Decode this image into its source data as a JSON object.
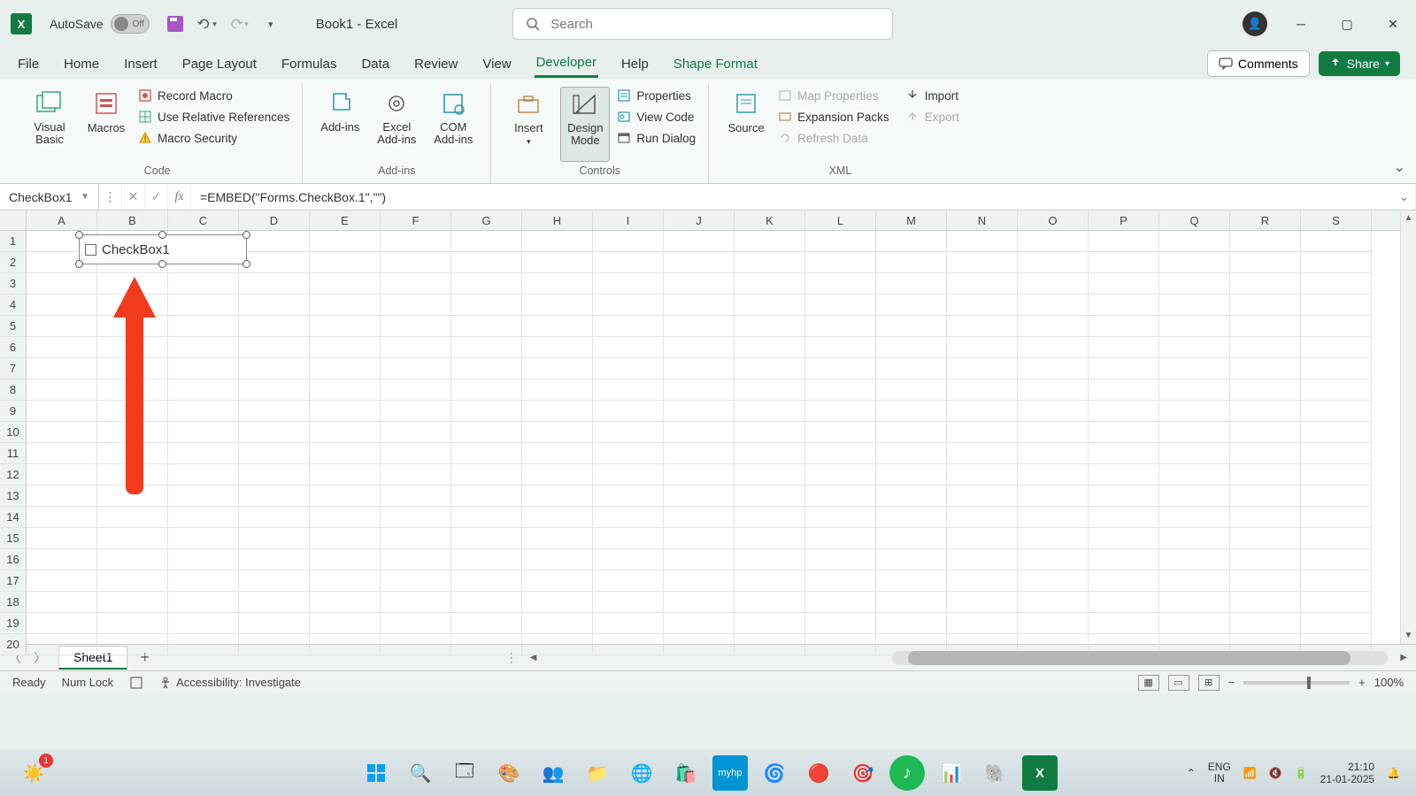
{
  "titlebar": {
    "autosave_label": "AutoSave",
    "autosave_state": "Off",
    "doc_title": "Book1  -  Excel",
    "search_placeholder": "Search"
  },
  "tabs": {
    "items": [
      "File",
      "Home",
      "Insert",
      "Page Layout",
      "Formulas",
      "Data",
      "Review",
      "View",
      "Developer",
      "Help",
      "Shape Format"
    ],
    "active": "Developer",
    "comments": "Comments",
    "share": "Share"
  },
  "ribbon": {
    "code": {
      "visual_basic": "Visual Basic",
      "macros": "Macros",
      "record_macro": "Record Macro",
      "use_relative": "Use Relative References",
      "macro_security": "Macro Security",
      "label": "Code"
    },
    "addins": {
      "addins": "Add-ins",
      "excel_addins": "Excel Add-ins",
      "com_addins": "COM Add-ins",
      "label": "Add-ins"
    },
    "controls": {
      "insert": "Insert",
      "design_mode": "Design Mode",
      "properties": "Properties",
      "view_code": "View Code",
      "run_dialog": "Run Dialog",
      "label": "Controls"
    },
    "xml": {
      "source": "Source",
      "map_properties": "Map Properties",
      "expansion_packs": "Expansion Packs",
      "refresh_data": "Refresh Data",
      "import": "Import",
      "export": "Export",
      "label": "XML"
    }
  },
  "formula_bar": {
    "name_box": "CheckBox1",
    "formula": "=EMBED(\"Forms.CheckBox.1\",\"\")"
  },
  "grid": {
    "columns": [
      "A",
      "B",
      "C",
      "D",
      "E",
      "F",
      "G",
      "H",
      "I",
      "J",
      "K",
      "L",
      "M",
      "N",
      "O",
      "P",
      "Q",
      "R",
      "S"
    ],
    "rows": 20,
    "checkbox_label": "CheckBox1"
  },
  "sheet_bar": {
    "sheet": "Sheet1"
  },
  "status": {
    "ready": "Ready",
    "numlock": "Num Lock",
    "accessibility": "Accessibility: Investigate",
    "zoom": "100%"
  },
  "taskbar": {
    "lang1": "ENG",
    "lang2": "IN",
    "time": "21:10",
    "date": "21-01-2025"
  }
}
